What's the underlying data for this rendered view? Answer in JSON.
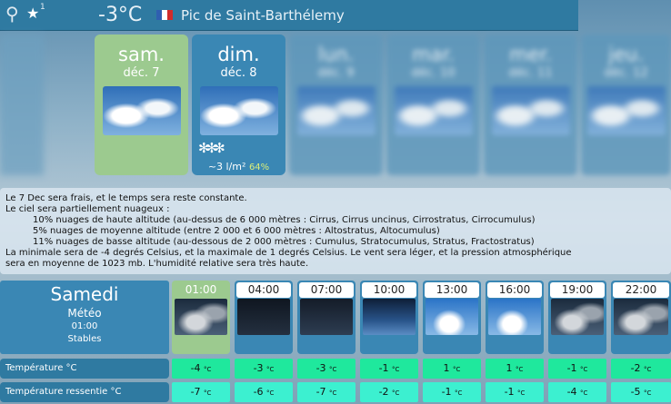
{
  "header": {
    "pin_icon": "map-pin-icon",
    "star_icon": "star-icon",
    "badge": "1",
    "temperature": "-3°C",
    "flag_colors": [
      "#2f5fb0",
      "#ffffff",
      "#d22b2b"
    ],
    "location": "Pic de Saint-Barthélemy"
  },
  "days": [
    {
      "name": "sam.",
      "date": "déc. 7"
    },
    {
      "name": "dim.",
      "date": "déc. 8",
      "precip": "~3 l/m²",
      "precip_pct": "64%"
    },
    {
      "name": "lun.",
      "date": "déc. 9"
    },
    {
      "name": "mar.",
      "date": "déc. 10"
    },
    {
      "name": "mer.",
      "date": "déc. 11"
    },
    {
      "name": "jeu.",
      "date": "déc. 12"
    }
  ],
  "description": {
    "line1": "Le 7 Dec sera frais, et le temps sera reste constante.",
    "line2": "Le ciel sera partiellement nuageux :",
    "line3": "10% nuages de haute altitude (au-dessus de 6 000 mètres : Cirrus, Cirrus uncinus, Cirrostratus, Cirrocumulus)",
    "line4": "5% nuages de moyenne altitude (entre 2 000 et 6 000 mètres : Altostratus, Altocumulus)",
    "line5": "11% nuages de basse altitude (au-dessous de 2 000 mètres : Cumulus, Stratocumulus, Stratus, Fractostratus)",
    "line6": "La minimale sera de -4 degrés Celsius, et la maximale de 1 degrés Celsius. Le vent sera léger, et la pression atmosphérique",
    "line7": "sera en moyenne de 1023 mb. L'humidité relative sera très haute."
  },
  "daypanel": {
    "day": "Samedi",
    "subtitle": "Météo",
    "time": "01:00",
    "status": "Stables"
  },
  "rows": {
    "temp_label": "Température °C",
    "feel_label": "Température ressentie °C"
  },
  "hours": [
    {
      "time": "01:00",
      "temp": "-4",
      "feel": "-7"
    },
    {
      "time": "04:00",
      "temp": "-3",
      "feel": "-6"
    },
    {
      "time": "07:00",
      "temp": "-3",
      "feel": "-7"
    },
    {
      "time": "10:00",
      "temp": "-1",
      "feel": "-2"
    },
    {
      "time": "13:00",
      "temp": "1",
      "feel": "-1"
    },
    {
      "time": "16:00",
      "temp": "1",
      "feel": "-1"
    },
    {
      "time": "19:00",
      "temp": "-1",
      "feel": "-4"
    },
    {
      "time": "22:00",
      "temp": "-2",
      "feel": "-5"
    }
  ],
  "unit": "°C"
}
